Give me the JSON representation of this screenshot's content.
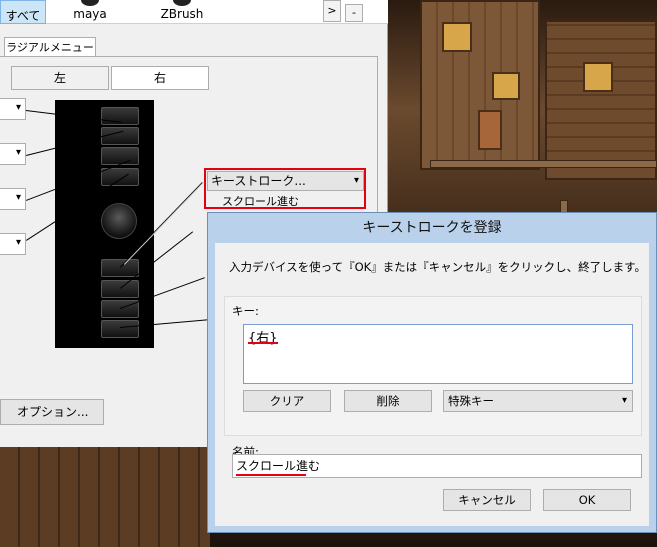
{
  "app_strip": {
    "all_label": "すべて",
    "apps": [
      "maya",
      "ZBrush"
    ],
    "next_label": ">",
    "minus_label": "-"
  },
  "tabs": {
    "radial_menu": "ラジアルメニュー"
  },
  "handedness": {
    "left": "左",
    "right": "右"
  },
  "assignment": {
    "selected": "キーストローク...",
    "sub_label": "スクロール進む",
    "highlight_color": "#e3000f"
  },
  "options_button": "オプション...",
  "dialog": {
    "title": "キーストロークを登録",
    "instruction": "入力デバイスを使って『OK』または『キャンセル』をクリックし、終了します。",
    "key_label": "キー:",
    "key_value": "{右}",
    "clear_label": "クリア",
    "delete_label": "削除",
    "special_key_label": "特殊キー",
    "name_label": "名前:",
    "name_value": "スクロール進む",
    "cancel_label": "キャンセル",
    "ok_label": "OK"
  },
  "colors": {
    "title_bar": "#b9d1ea",
    "tablet_glow": "#2f7cff"
  }
}
